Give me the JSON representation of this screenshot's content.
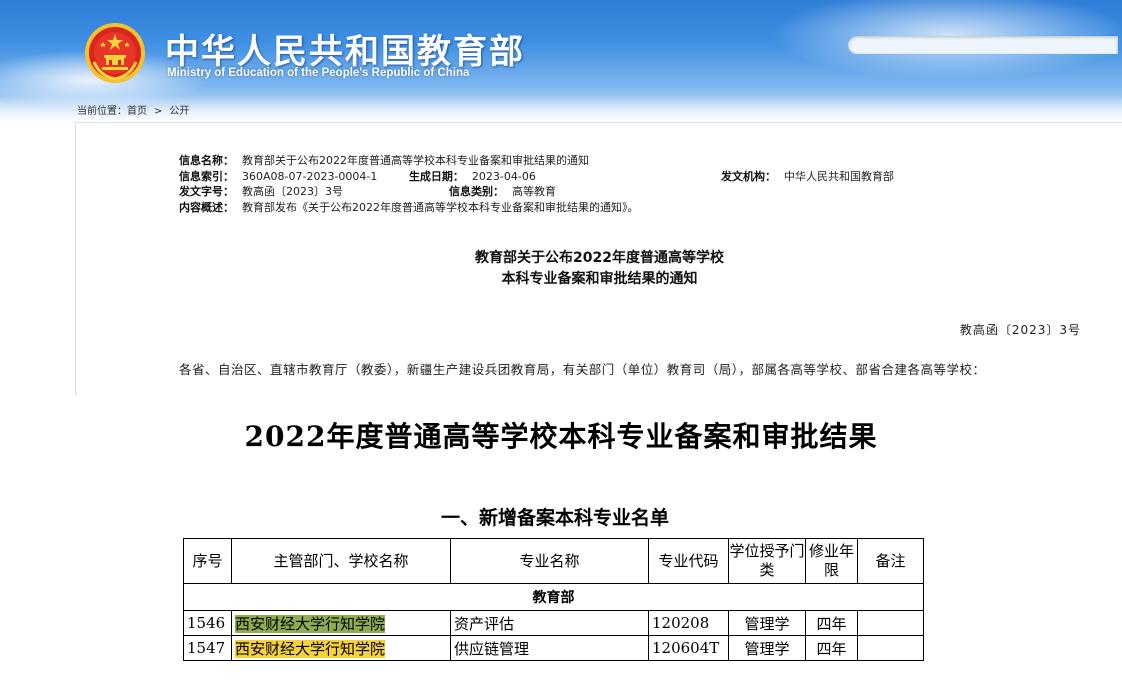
{
  "header": {
    "site_title": "中华人民共和国教育部",
    "site_subtitle": "Ministry of Education of the People's Republic of China",
    "emblem_icon": "national-emblem-icon",
    "search": {
      "value": "",
      "placeholder": ""
    }
  },
  "breadcrumb": {
    "label": "当前位置：",
    "items": [
      "首页",
      "公开"
    ],
    "separator": ">"
  },
  "article": {
    "info": {
      "name_label": "信息名称：",
      "name_value": "教育部关于公布2022年度普通高等学校本科专业备案和审批结果的通知",
      "index_label": "信息索引：",
      "index_value": "360A08-07-2023-0004-1",
      "date_label": "生成日期：",
      "date_value": "2023-04-06",
      "issuer_label": "发文机构：",
      "issuer_value": "中华人民共和国教育部",
      "docno_label": "发文字号：",
      "docno_value": "教高函〔2023〕3号",
      "category_label": "信息类别：",
      "category_value": "高等教育",
      "summary_label": "内容概述：",
      "summary_value": "教育部发布《关于公布2022年度普通高等学校本科专业备案和审批结果的通知》。"
    },
    "heading_line1": "教育部关于公布2022年度普通高等学校",
    "heading_line2": "本科专业备案和审批结果的通知",
    "doc_number": "教高函〔2023〕3号",
    "salutation": "各省、自治区、直辖市教育厅（教委），新疆生产建设兵团教育局，有关部门（单位）教育司（局），部属各高等学校、部省合建各高等学校："
  },
  "results": {
    "title": "2022年度普通高等学校本科专业备案和审批结果",
    "list_heading": "一、新增备案本科专业名单",
    "columns": [
      "序号",
      "主管部门、学校名称",
      "专业名称",
      "专业代码",
      "学位授予门类",
      "修业年限",
      "备注"
    ],
    "department": "教育部",
    "rows": [
      {
        "no": "1546",
        "school": "西安财经大学行知学院",
        "major": "资产评估",
        "code": "120208",
        "degree": "管理学",
        "years": "四年",
        "note": "",
        "highlight": "#8fad4d"
      },
      {
        "no": "1547",
        "school": "西安财经大学行知学院",
        "major": "供应链管理",
        "code": "120604T",
        "degree": "管理学",
        "years": "四年",
        "note": "",
        "highlight": "#f5d13e"
      }
    ]
  }
}
